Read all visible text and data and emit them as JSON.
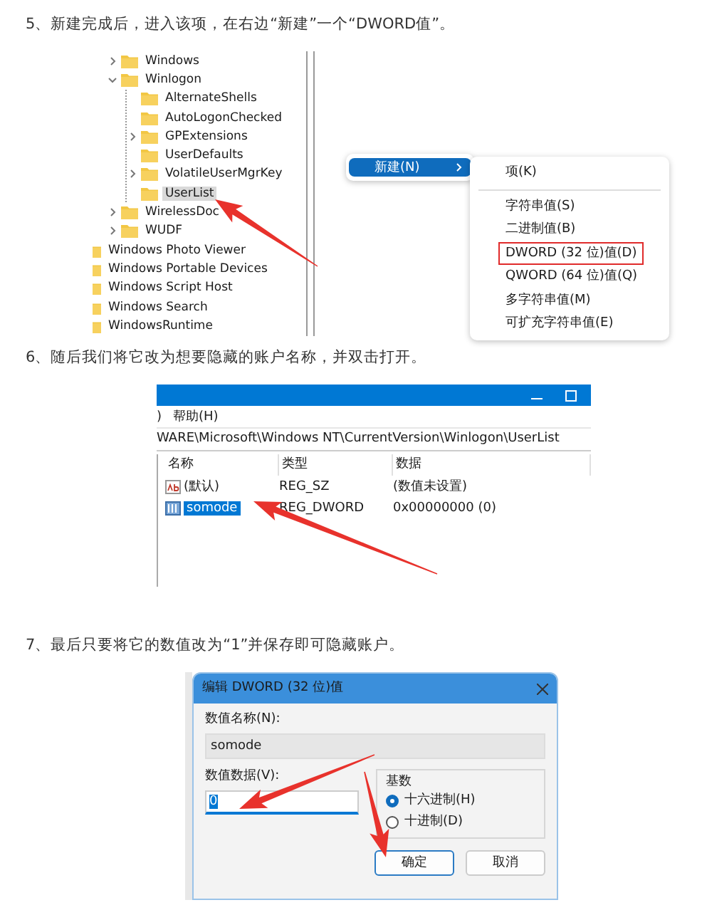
{
  "steps": [
    {
      "text": "5、新建完成后，进入该项，在右边“新建”一个“DWORD值”。"
    },
    {
      "text": "6、随后我们将它改为想要隐藏的账户名称，并双击打开。"
    },
    {
      "text": "7、最后只要将它的数值改为“1”并保存即可隐藏账户。"
    }
  ],
  "registry_tree": {
    "inner_items": [
      {
        "label": "Windows",
        "kind": "collapsed",
        "selected": false
      },
      {
        "label": "Winlogon",
        "kind": "expanded",
        "selected": false,
        "children": [
          {
            "label": "AlternateShells",
            "kind": "leaf",
            "selected": false
          },
          {
            "label": "AutoLogonChecked",
            "kind": "leaf",
            "selected": false
          },
          {
            "label": "GPExtensions",
            "kind": "collapsed",
            "selected": false
          },
          {
            "label": "UserDefaults",
            "kind": "leaf",
            "selected": false
          },
          {
            "label": "VolatileUserMgrKey",
            "kind": "collapsed",
            "selected": false
          },
          {
            "label": "UserList",
            "kind": "leaf",
            "selected": true
          }
        ]
      },
      {
        "label": "WirelessDoc",
        "kind": "collapsed",
        "selected": false
      },
      {
        "label": "WUDF",
        "kind": "collapsed",
        "selected": false
      }
    ],
    "outer_items": [
      {
        "label": "Windows Photo Viewer",
        "selected": false
      },
      {
        "label": "Windows Portable Devices",
        "selected": false
      },
      {
        "label": "Windows Script Host",
        "selected": false
      },
      {
        "label": "Windows Search",
        "selected": false
      },
      {
        "label": "WindowsRuntime",
        "selected": false
      }
    ]
  },
  "context_menu": {
    "item": {
      "label": "新建(N)",
      "selected": true
    },
    "submenu": {
      "groups": [
        [
          {
            "label": "项(K)",
            "outlined": false
          }
        ],
        [
          {
            "label": "字符串值(S)",
            "outlined": false
          },
          {
            "label": "二进制值(B)",
            "outlined": false
          },
          {
            "label": "DWORD (32 位)值(D)",
            "outlined": true
          },
          {
            "label": "QWORD (64 位)值(Q)",
            "outlined": false
          },
          {
            "label": "多字符串值(M)",
            "outlined": false
          },
          {
            "label": "可扩充字符串值(E)",
            "outlined": false
          }
        ]
      ]
    }
  },
  "registry_editor": {
    "menu": [
      ")",
      "帮助(H)"
    ],
    "address": "WARE\\Microsoft\\Windows NT\\CurrentVersion\\Winlogon\\UserList",
    "columns": [
      "名称",
      "类型",
      "数据"
    ],
    "rows": [
      {
        "kind": "string",
        "name": "(默认)",
        "type": "REG_SZ",
        "data": "(数值未设置)",
        "selected": false
      },
      {
        "kind": "dword",
        "name": "somode",
        "type": "REG_DWORD",
        "data": "0x00000000 (0)",
        "selected": true
      }
    ]
  },
  "dword_dialog": {
    "title": "编辑 DWORD (32 位)值",
    "name_label": "数值名称(N):",
    "name_value": "somode",
    "data_label": "数值数据(V):",
    "data_value": "0",
    "base_label": "基数",
    "bases": [
      {
        "label": "十六进制(H)",
        "selected": true
      },
      {
        "label": "十进制(D)",
        "selected": false
      }
    ],
    "buttons": [
      {
        "label": "确定",
        "default": true
      },
      {
        "label": "取消",
        "default": false
      }
    ]
  }
}
